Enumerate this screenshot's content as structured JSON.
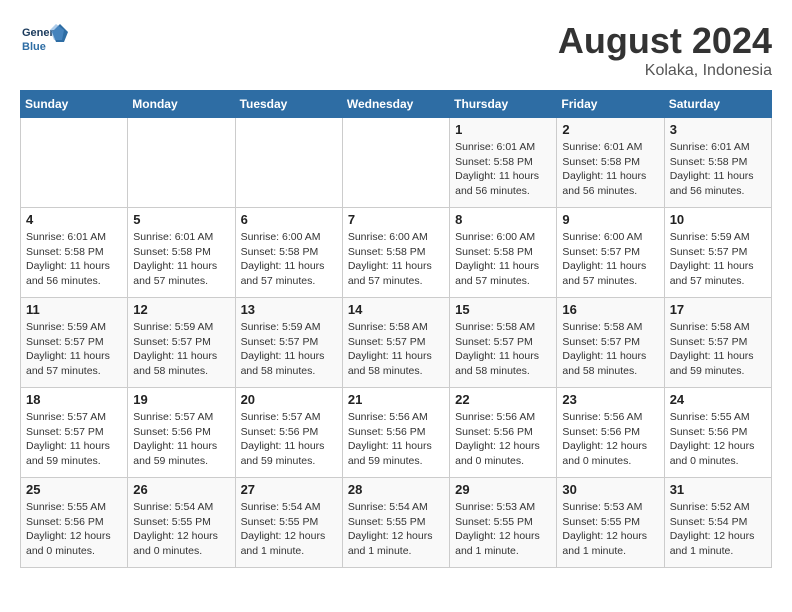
{
  "header": {
    "logo_general": "General",
    "logo_blue": "Blue",
    "month_title": "August 2024",
    "location": "Kolaka, Indonesia"
  },
  "weekdays": [
    "Sunday",
    "Monday",
    "Tuesday",
    "Wednesday",
    "Thursday",
    "Friday",
    "Saturday"
  ],
  "weeks": [
    [
      {
        "day": "",
        "info": ""
      },
      {
        "day": "",
        "info": ""
      },
      {
        "day": "",
        "info": ""
      },
      {
        "day": "",
        "info": ""
      },
      {
        "day": "1",
        "info": "Sunrise: 6:01 AM\nSunset: 5:58 PM\nDaylight: 11 hours and 56 minutes."
      },
      {
        "day": "2",
        "info": "Sunrise: 6:01 AM\nSunset: 5:58 PM\nDaylight: 11 hours and 56 minutes."
      },
      {
        "day": "3",
        "info": "Sunrise: 6:01 AM\nSunset: 5:58 PM\nDaylight: 11 hours and 56 minutes."
      }
    ],
    [
      {
        "day": "4",
        "info": "Sunrise: 6:01 AM\nSunset: 5:58 PM\nDaylight: 11 hours and 56 minutes."
      },
      {
        "day": "5",
        "info": "Sunrise: 6:01 AM\nSunset: 5:58 PM\nDaylight: 11 hours and 57 minutes."
      },
      {
        "day": "6",
        "info": "Sunrise: 6:00 AM\nSunset: 5:58 PM\nDaylight: 11 hours and 57 minutes."
      },
      {
        "day": "7",
        "info": "Sunrise: 6:00 AM\nSunset: 5:58 PM\nDaylight: 11 hours and 57 minutes."
      },
      {
        "day": "8",
        "info": "Sunrise: 6:00 AM\nSunset: 5:58 PM\nDaylight: 11 hours and 57 minutes."
      },
      {
        "day": "9",
        "info": "Sunrise: 6:00 AM\nSunset: 5:57 PM\nDaylight: 11 hours and 57 minutes."
      },
      {
        "day": "10",
        "info": "Sunrise: 5:59 AM\nSunset: 5:57 PM\nDaylight: 11 hours and 57 minutes."
      }
    ],
    [
      {
        "day": "11",
        "info": "Sunrise: 5:59 AM\nSunset: 5:57 PM\nDaylight: 11 hours and 57 minutes."
      },
      {
        "day": "12",
        "info": "Sunrise: 5:59 AM\nSunset: 5:57 PM\nDaylight: 11 hours and 58 minutes."
      },
      {
        "day": "13",
        "info": "Sunrise: 5:59 AM\nSunset: 5:57 PM\nDaylight: 11 hours and 58 minutes."
      },
      {
        "day": "14",
        "info": "Sunrise: 5:58 AM\nSunset: 5:57 PM\nDaylight: 11 hours and 58 minutes."
      },
      {
        "day": "15",
        "info": "Sunrise: 5:58 AM\nSunset: 5:57 PM\nDaylight: 11 hours and 58 minutes."
      },
      {
        "day": "16",
        "info": "Sunrise: 5:58 AM\nSunset: 5:57 PM\nDaylight: 11 hours and 58 minutes."
      },
      {
        "day": "17",
        "info": "Sunrise: 5:58 AM\nSunset: 5:57 PM\nDaylight: 11 hours and 59 minutes."
      }
    ],
    [
      {
        "day": "18",
        "info": "Sunrise: 5:57 AM\nSunset: 5:57 PM\nDaylight: 11 hours and 59 minutes."
      },
      {
        "day": "19",
        "info": "Sunrise: 5:57 AM\nSunset: 5:56 PM\nDaylight: 11 hours and 59 minutes."
      },
      {
        "day": "20",
        "info": "Sunrise: 5:57 AM\nSunset: 5:56 PM\nDaylight: 11 hours and 59 minutes."
      },
      {
        "day": "21",
        "info": "Sunrise: 5:56 AM\nSunset: 5:56 PM\nDaylight: 11 hours and 59 minutes."
      },
      {
        "day": "22",
        "info": "Sunrise: 5:56 AM\nSunset: 5:56 PM\nDaylight: 12 hours and 0 minutes."
      },
      {
        "day": "23",
        "info": "Sunrise: 5:56 AM\nSunset: 5:56 PM\nDaylight: 12 hours and 0 minutes."
      },
      {
        "day": "24",
        "info": "Sunrise: 5:55 AM\nSunset: 5:56 PM\nDaylight: 12 hours and 0 minutes."
      }
    ],
    [
      {
        "day": "25",
        "info": "Sunrise: 5:55 AM\nSunset: 5:56 PM\nDaylight: 12 hours and 0 minutes."
      },
      {
        "day": "26",
        "info": "Sunrise: 5:54 AM\nSunset: 5:55 PM\nDaylight: 12 hours and 0 minutes."
      },
      {
        "day": "27",
        "info": "Sunrise: 5:54 AM\nSunset: 5:55 PM\nDaylight: 12 hours and 1 minute."
      },
      {
        "day": "28",
        "info": "Sunrise: 5:54 AM\nSunset: 5:55 PM\nDaylight: 12 hours and 1 minute."
      },
      {
        "day": "29",
        "info": "Sunrise: 5:53 AM\nSunset: 5:55 PM\nDaylight: 12 hours and 1 minute."
      },
      {
        "day": "30",
        "info": "Sunrise: 5:53 AM\nSunset: 5:55 PM\nDaylight: 12 hours and 1 minute."
      },
      {
        "day": "31",
        "info": "Sunrise: 5:52 AM\nSunset: 5:54 PM\nDaylight: 12 hours and 1 minute."
      }
    ]
  ]
}
